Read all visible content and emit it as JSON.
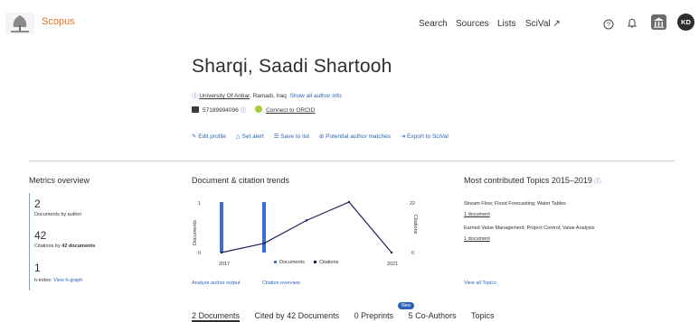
{
  "header": {
    "brand": "Scopus",
    "nav": [
      "Search",
      "Sources",
      "Lists",
      "SciVal ↗"
    ],
    "avatar_initials": "KD"
  },
  "author": {
    "name": "Sharqi, Saadi Shartooh",
    "institution": "University Of Anbar",
    "location": ", Ramadi, Iraq",
    "show_all_info": "Show all author info",
    "scopus_id": "57189994096",
    "orcid_link": "Connect to ORCID"
  },
  "actions": {
    "edit_profile": "Edit profile",
    "set_alert": "Set alert",
    "save_to_list": "Save to list",
    "potential_matches": "Potential author matches",
    "export": "Export to SciVal"
  },
  "metrics": {
    "title": "Metrics overview",
    "documents_value": "2",
    "documents_label": "Documents by author",
    "citations_value": "42",
    "citations_label_pre": "Citations by ",
    "citations_label_num": "42 documents",
    "hindex_value": "1",
    "hindex_label": "h-index:",
    "hindex_link": "View h-graph"
  },
  "trends": {
    "title": "Document & citation trends",
    "analyze_link": "Analyze author output",
    "citation_overview_link": "Citation overview"
  },
  "chart_data": {
    "type": "bar",
    "title": "Document & citation trends",
    "x": [
      "2017",
      "2018",
      "2019",
      "2020",
      "2021"
    ],
    "x_tick_labels": [
      "2017",
      "2021"
    ],
    "series": [
      {
        "name": "Documents",
        "kind": "bar",
        "axis": "left",
        "values": [
          1,
          1,
          0,
          0,
          0
        ]
      },
      {
        "name": "Citations",
        "kind": "line",
        "axis": "right",
        "values": [
          0,
          4,
          14,
          22,
          0
        ]
      }
    ],
    "ylabel_left": "Documents",
    "ylabel_right": "Citations",
    "ylim_left": [
      0,
      1
    ],
    "ylim_right": [
      0,
      22
    ],
    "left_ticks": [
      "0",
      "1"
    ],
    "right_ticks": [
      "0",
      "22"
    ],
    "colors": {
      "documents": "#3b6fd6",
      "citations": "#1f1f5c"
    },
    "legend": "bottom"
  },
  "topics": {
    "title": "Most contributed Topics 2015–2019",
    "items": [
      {
        "name": "Stream Flow; Flood Forecasting; Water Tables",
        "count": "1 document"
      },
      {
        "name": "Earned Value Management; Project Control; Value Analysis",
        "count": "1 document"
      }
    ],
    "view_all": "View all Topics"
  },
  "tabs": {
    "documents": "2 Documents",
    "cited_by": "Cited by 42 Documents",
    "preprints": "0 Preprints",
    "new_badge": "New",
    "coauthors": "5 Co-Authors",
    "topics": "Topics"
  }
}
